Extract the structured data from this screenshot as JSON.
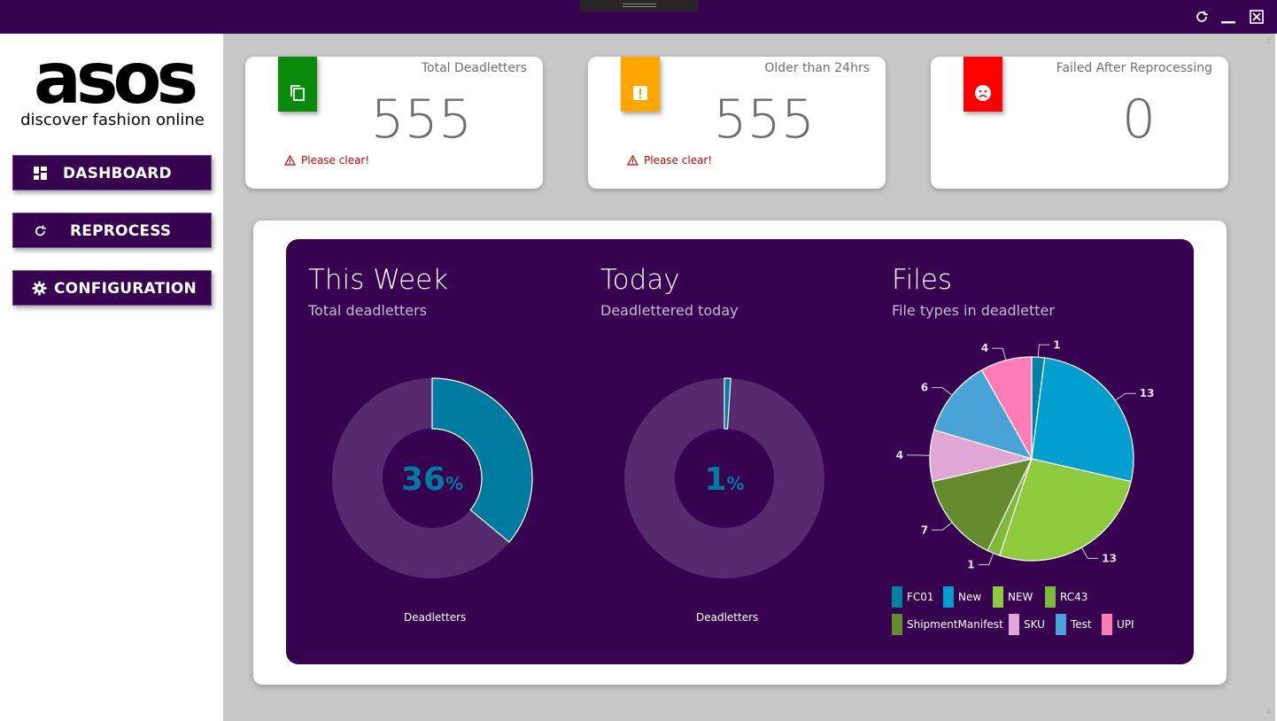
{
  "window": {
    "buttons": [
      "refresh-icon",
      "minimize-icon",
      "close-icon"
    ]
  },
  "brand": {
    "logo_text": "asos",
    "tagline": "discover fashion online"
  },
  "sidebar": {
    "items": [
      {
        "label": "DASHBOARD",
        "icon": "dashboard-icon"
      },
      {
        "label": "REPROCESS",
        "icon": "refresh-icon"
      },
      {
        "label": "CONFIGURATION",
        "icon": "gear-icon"
      }
    ]
  },
  "cards": [
    {
      "title": "Total Deadletters",
      "value": "555",
      "warning": "Please clear!",
      "badge_color": "#0a8a0a",
      "icon": "copy-icon"
    },
    {
      "title": "Older than 24hrs",
      "value": "555",
      "warning": "Please clear!",
      "badge_color": "#ffa500",
      "icon": "alert-icon"
    },
    {
      "title": "Failed After Reprocessing",
      "value": "0",
      "warning": "",
      "badge_color": "#ff0000",
      "icon": "sad-face-icon"
    }
  ],
  "sections": [
    {
      "title": "This Week",
      "subtitle": "Total deadletters",
      "center_value": "36",
      "center_unit": "%",
      "caption": "Deadletters"
    },
    {
      "title": "Today",
      "subtitle": "Deadlettered today",
      "center_value": "1",
      "center_unit": "%",
      "caption": "Deadletters"
    },
    {
      "title": "Files",
      "subtitle": "File types in deadletter"
    }
  ],
  "colors": {
    "accent": "#370250",
    "donut_fill": "#007ba0",
    "donut_track": "#57296e"
  },
  "chart_data": [
    {
      "type": "pie",
      "title": "This Week",
      "subtitle": "Total deadletters",
      "categories": [
        "Deadletters",
        ""
      ],
      "values": [
        36,
        64
      ],
      "center_label": "36%",
      "caption": "Deadletters"
    },
    {
      "type": "pie",
      "title": "Today",
      "subtitle": "Deadlettered today",
      "categories": [
        "Deadletters",
        ""
      ],
      "values": [
        1,
        99
      ],
      "center_label": "1%",
      "caption": "Deadletters"
    },
    {
      "type": "pie",
      "title": "Files",
      "subtitle": "File types in deadletter",
      "categories": [
        "FC01",
        "New",
        "NEW",
        "RC43",
        "ShipmentManifest",
        "SKU",
        "Test",
        "UPI"
      ],
      "values": [
        1,
        13,
        13,
        1,
        7,
        4,
        6,
        4
      ],
      "colors": [
        "#0082a0",
        "#009fd0",
        "#8dcb3c",
        "#7dba3a",
        "#658c2c",
        "#e0a6d4",
        "#4aa3d6",
        "#ff7cb6"
      ],
      "legend_position": "bottom"
    }
  ]
}
